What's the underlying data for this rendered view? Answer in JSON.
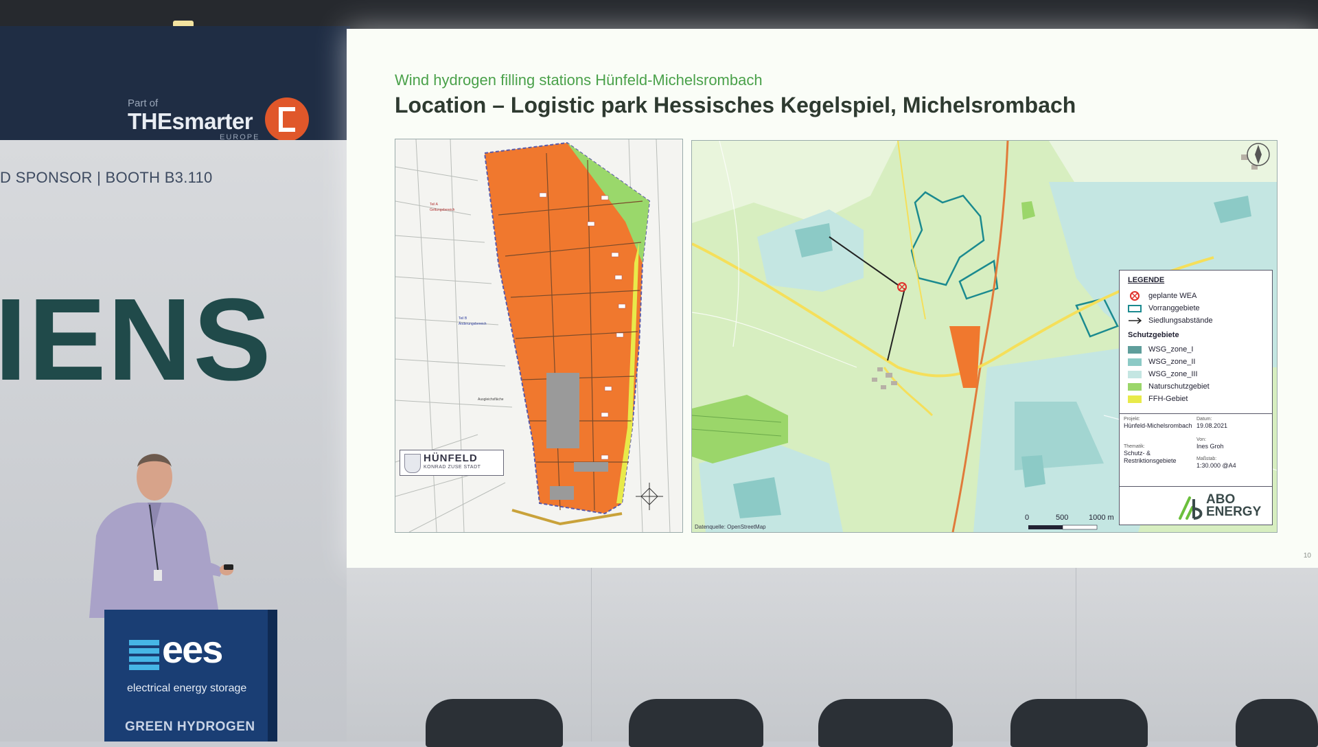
{
  "event": {
    "sponsor_banner": "D SPONSOR | BOOTH B3.110",
    "brand_letters": "IENS",
    "smarter_logo": {
      "part_of": "Part of",
      "name": "THEsmarter",
      "region": "EUROPE"
    },
    "podium": {
      "logo": "ees",
      "tagline": "electrical energy storage",
      "label": "GREEN HYDROGEN"
    }
  },
  "slide": {
    "subtitle": "Wind hydrogen filling stations Hünfeld-Michelsrombach",
    "title": "Location – Logistic park Hessisches Kegelspiel, Michelsrombach",
    "page_number": "10"
  },
  "left_map": {
    "town": "HÜNFELD",
    "town_subtitle": "KONRAD ZUSE STADT"
  },
  "right_map": {
    "data_source": "Datenquelle: OpenStreetMap",
    "scale": [
      "0",
      "500",
      "1000 m"
    ],
    "legend": {
      "title": "LEGENDE",
      "items": [
        {
          "label": "geplante WEA",
          "color": "#e0302a"
        },
        {
          "label": "Vorranggebiete",
          "color": "#1b8a8f"
        },
        {
          "label": "Siedlungsabstände",
          "color": "#222222"
        }
      ],
      "protection_title": "Schutzgebiete",
      "protection_items": [
        {
          "label": "WSG_zone_I",
          "color": "#5f9e9b"
        },
        {
          "label": "WSG_zone_II",
          "color": "#8ccac6"
        },
        {
          "label": "WSG_zone_III",
          "color": "#c4e6e2"
        },
        {
          "label": "Naturschutzgebiet",
          "color": "#9bd66a"
        },
        {
          "label": "FFH-Gebiet",
          "color": "#e8ea4a"
        }
      ]
    },
    "info": {
      "project_key": "Projekt:",
      "project": "Hünfeld-Michelsrombach",
      "date_key": "Datum:",
      "date": "19.08.2021",
      "author_key": "Von:",
      "author": "Ines Groh",
      "topic_key": "Thematik:",
      "topic": "Schutz- & Restriktionsgebiete",
      "scale_key": "Maßstab:",
      "scale": "1:30.000 @A4"
    },
    "company": {
      "line1": "ABO",
      "line2": "ENERGY"
    }
  },
  "colors": {
    "slide_subtitle": "#4aa14a",
    "planned_area": "#f0782e",
    "podium": "#1a3e74"
  }
}
